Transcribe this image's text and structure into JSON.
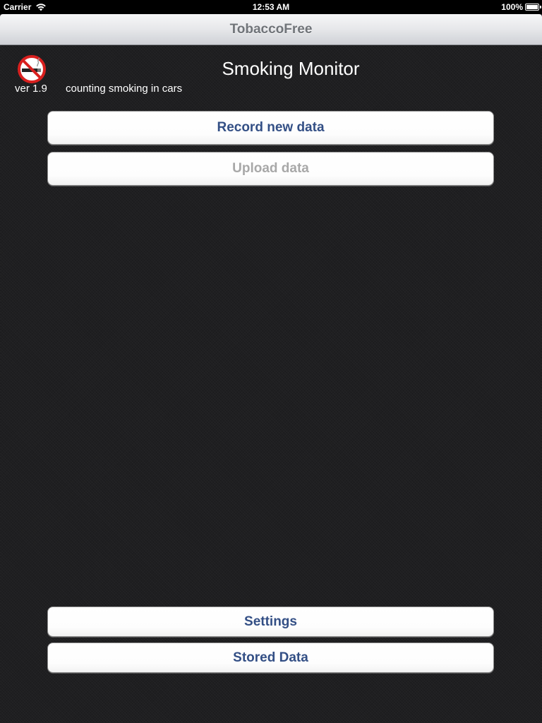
{
  "status_bar": {
    "carrier": "Carrier",
    "time": "12:53 AM",
    "battery": "100%",
    "wifi_icon": "wifi-icon",
    "battery_icon": "battery-icon"
  },
  "nav": {
    "title": "TobaccoFree"
  },
  "header": {
    "icon": "no-smoking-icon",
    "version": "ver 1.9",
    "subtitle": "counting smoking in cars",
    "title": "Smoking Monitor"
  },
  "buttons": {
    "record": "Record new data",
    "upload": "Upload data",
    "settings": "Settings",
    "stored": "Stored Data"
  },
  "colors": {
    "button_text": "#334f85",
    "button_disabled_text": "#a8a8a8",
    "background": "#1f1f21",
    "no_smoking_red": "#d9201f"
  }
}
